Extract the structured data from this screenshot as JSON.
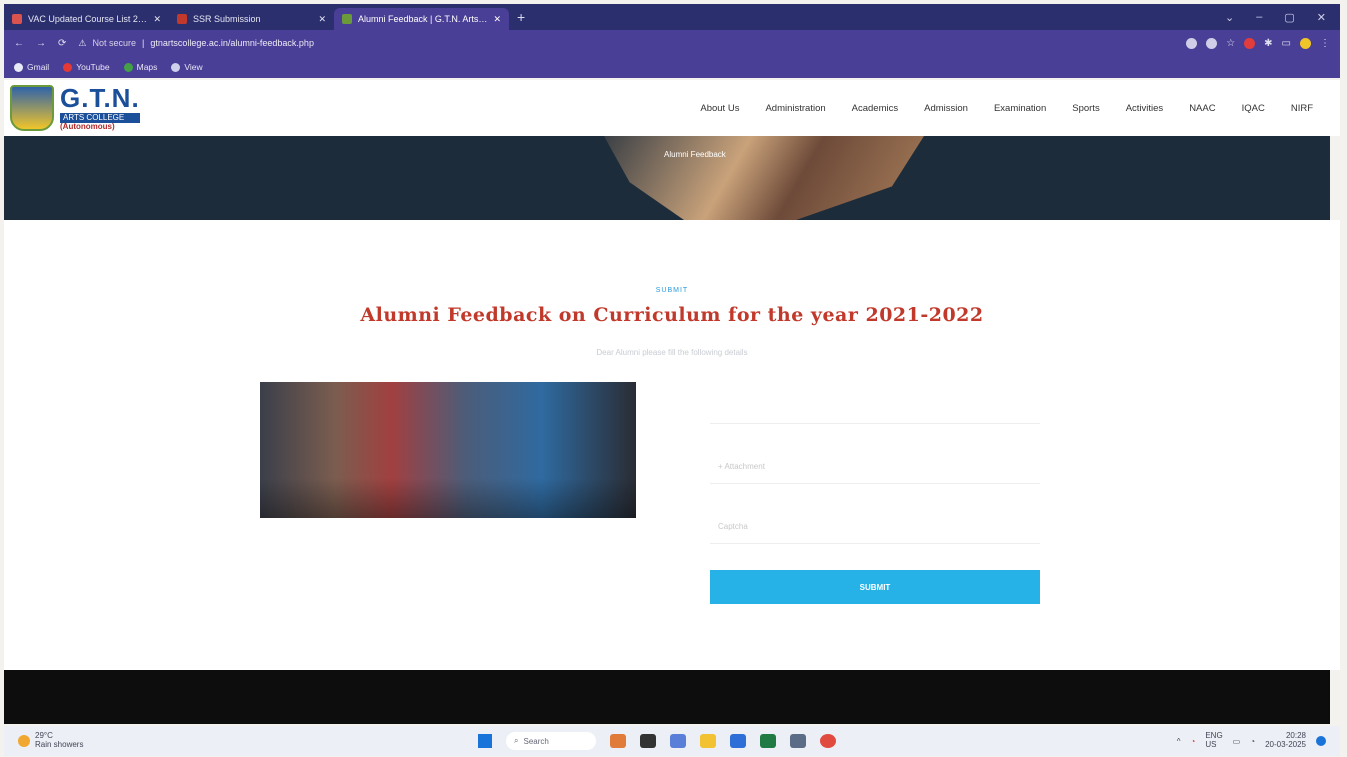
{
  "browser": {
    "tabs": [
      {
        "title": "VAC Updated Course List 21-22",
        "color": "#d9534f"
      },
      {
        "title": "SSR Submission",
        "color": "#c0392b"
      },
      {
        "title": "Alumni Feedback | G.T.N. Arts ar",
        "color": "#6a9a3a"
      }
    ],
    "new_tab": "+",
    "url_prefix": "Not secure",
    "url": "gtnartscollege.ac.in/alumni-feedback.php",
    "bookmarks": [
      "Gmail",
      "YouTube",
      "Maps",
      "View"
    ]
  },
  "site": {
    "logo_big": "G.T.N.",
    "logo_sub": "ARTS COLLEGE",
    "logo_auto": "(Autonomous)",
    "nav": [
      "About Us",
      "Administration",
      "Academics",
      "Admission",
      "Examination",
      "Sports",
      "Activities",
      "NAAC",
      "IQAC",
      "NIRF"
    ],
    "hero_caption": "Alumni Feedback"
  },
  "main": {
    "eyebrow": "SUBMIT",
    "heading": "Alumni Feedback on Curriculum for the year 2021-2022",
    "subline": "Dear Alumni please fill the following details",
    "field_1": "",
    "field_2": "+ Attachment",
    "field_3": "Captcha",
    "submit_label": "SUBMIT"
  },
  "taskbar": {
    "temp": "29°C",
    "weather": "Rain showers",
    "search": "Search",
    "lang": "ENG",
    "region": "US",
    "time": "20:28",
    "date": "20-03-2025"
  }
}
